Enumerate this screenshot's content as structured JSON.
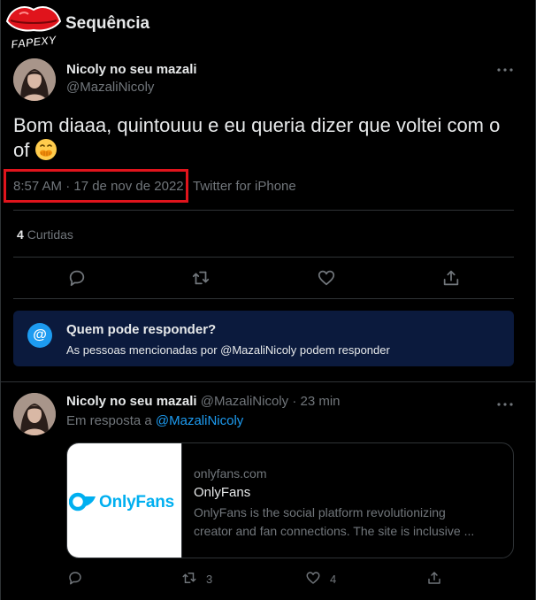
{
  "header": {
    "title": "Sequência",
    "logo_text": "FAPEXY"
  },
  "main_tweet": {
    "author_name": "Nicoly no seu mazali",
    "author_handle": "@MazaliNicoly",
    "text": "Bom diaaa, quintouuu e eu queria dizer que voltei com o of",
    "emoji": "face-with-hand-over-mouth",
    "time_date": "8:57 AM · 17 de nov de 2022",
    "source": "Twitter for iPhone",
    "likes_count": "4",
    "likes_label": "Curtidas"
  },
  "reply_restriction": {
    "title": "Quem pode responder?",
    "subtitle": "As pessoas mencionadas por @MazaliNicoly podem responder",
    "icon": "@"
  },
  "reply_tweet": {
    "author_name": "Nicoly no seu mazali",
    "author_handle": "@MazaliNicoly",
    "separator": "·",
    "time": "23 min",
    "in_reply_prefix": "Em resposta a",
    "in_reply_handle": "@MazaliNicoly",
    "card": {
      "image_text": "OnlyFans",
      "domain": "onlyfans.com",
      "title": "OnlyFans",
      "desc_line1": "OnlyFans is the social platform revolutionizing",
      "desc_line2": "creator and fan connections. The site is inclusive ..."
    },
    "retweets": "3",
    "likes": "4"
  },
  "colors": {
    "background": "#000000",
    "accent": "#1d9bf0",
    "highlight_box": "#e0141c",
    "reply_box_bg": "#0b1a3d",
    "onlyfans_blue": "#00aff0"
  }
}
